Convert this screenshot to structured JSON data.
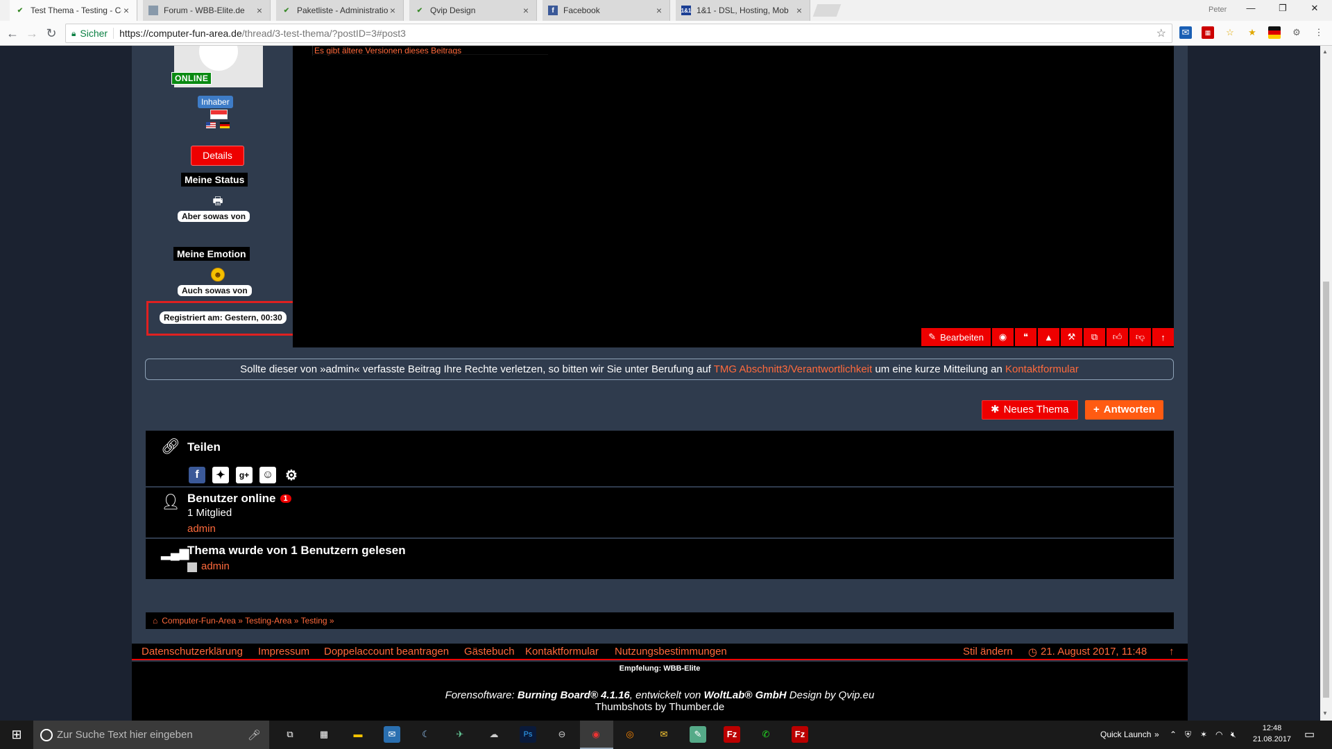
{
  "browser": {
    "tabs": [
      {
        "title": "Test Thema - Testing - Co",
        "active": true
      },
      {
        "title": "Forum - WBB-Elite.de",
        "active": false
      },
      {
        "title": "Paketliste - Administratio",
        "active": false
      },
      {
        "title": "Qvip Design",
        "active": false
      },
      {
        "title": "Facebook",
        "active": false
      },
      {
        "title": "1&1 - DSL, Hosting, Mob",
        "active": false
      }
    ],
    "profile_name": "Peter",
    "secure_label": "Sicher",
    "url_host": "https://computer-fun-area.de",
    "url_path": "/thread/3-test-thema/?postID=3#post3"
  },
  "sidebar": {
    "online_badge": "ONLINE",
    "rank": "Inhaber",
    "details_button": "Details",
    "status_heading": "Meine Status",
    "status_text": "Aber sowas von",
    "emotion_heading": "Meine Emotion",
    "emotion_text": "Auch sowas von",
    "registered": "Registriert am: Gestern, 00:30"
  },
  "post": {
    "older_versions": "Es gibt ältere Versionen dieses Beitrags",
    "edit_label": "Bearbeiten"
  },
  "notice": {
    "text1": "Sollte dieser von »admin« verfasste Beitrag Ihre Rechte verletzen, so bitten wir Sie unter Berufung auf",
    "link1": "TMG Abschnitt3/Verantwortlichkeit",
    "text2": "um eine kurze Mitteilung an",
    "link2": "Kontaktformular"
  },
  "buttons": {
    "new_thread": "Neues Thema",
    "reply": "Antworten"
  },
  "share": {
    "title": "Teilen"
  },
  "online": {
    "title": "Benutzer online",
    "count": "1",
    "members": "1 Mitglied",
    "user": "admin"
  },
  "read": {
    "title": "Thema wurde von 1 Benutzern gelesen",
    "user": "admin"
  },
  "breadcrumb": {
    "text": "Computer-Fun-Area » Testing-Area » Testing »"
  },
  "footer": {
    "links": [
      "Datenschutzerklärung",
      "Impressum",
      "Doppelaccount beantragen",
      "Gästebuch",
      "Kontaktformular",
      "Nutzungsbestimmungen"
    ],
    "style_change": "Stil ändern",
    "datetime": "21. August 2017, 11:48",
    "recommendation": "Empfelung: WBB-Elite",
    "software_prefix": "Forensoftware:",
    "software_name": "Burning Board® 4.1.16",
    "software_mid": ", entwickelt von",
    "software_vendor": "WoltLab® GmbH",
    "software_design": "Design by Qvip.eu",
    "thumbshots": "Thumbshots by Thumber.de"
  },
  "taskbar": {
    "search_placeholder": "Zur Suche Text hier eingeben",
    "quick_launch": "Quick Launch",
    "time": "12:48",
    "date": "21.08.2017"
  }
}
